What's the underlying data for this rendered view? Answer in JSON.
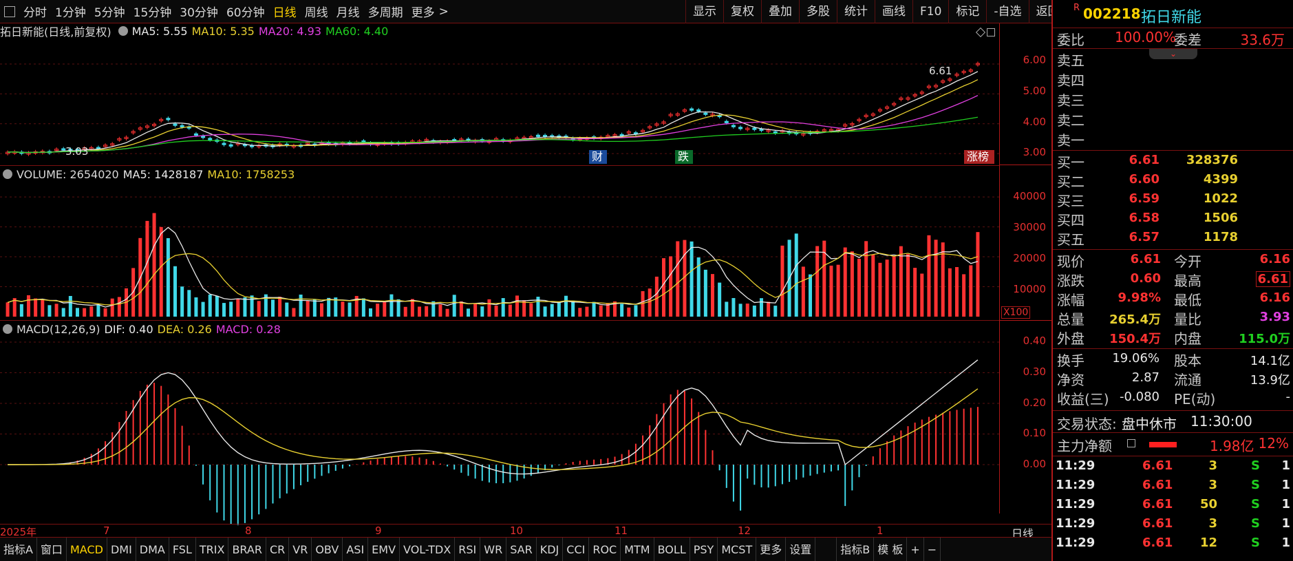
{
  "toolbar": {
    "periods": [
      "分时",
      "1分钟",
      "5分钟",
      "15分钟",
      "30分钟",
      "60分钟",
      "日线",
      "周线",
      "月线",
      "多周期",
      "更多"
    ],
    "active_period": "日线",
    "more_suffix": ">",
    "buttons": [
      "显示",
      "复权",
      "叠加",
      "多股",
      "统计",
      "画线",
      "F10",
      "标记",
      "-自选",
      "返回"
    ]
  },
  "stock": {
    "badge": "R",
    "code": "002218",
    "name": "拓日新能"
  },
  "kline": {
    "title": "拓日新能(日线,前复权)",
    "ma5": "MA5: 5.55",
    "ma10": "MA10: 5.35",
    "ma20": "MA20: 4.93",
    "ma60": "MA60: 4.40",
    "y_ticks": [
      "6.00",
      "5.00",
      "4.00",
      "3.00"
    ],
    "high_label": "6.61",
    "low_label": "3.03",
    "markers": [
      "财",
      "跌",
      "涨榜"
    ]
  },
  "volume": {
    "title": "VOLUME: 2654020",
    "ma5": "MA5: 1428187",
    "ma10": "MA10: 1758253",
    "y_ticks": [
      "40000",
      "30000",
      "20000",
      "10000"
    ],
    "unit": "X100"
  },
  "macd": {
    "title": "MACD(12,26,9)",
    "dif": "DIF: 0.40",
    "dea": "DEA: 0.26",
    "macd": "MACD: 0.28",
    "y_ticks": [
      "0.40",
      "0.30",
      "0.20",
      "0.10",
      "0.00"
    ]
  },
  "x_axis": {
    "labels": [
      "2025年",
      "7",
      "8",
      "9",
      "10",
      "11",
      "12",
      "1"
    ],
    "period_label": "日线"
  },
  "bottom_tabs": [
    "指标A",
    "窗口",
    "MACD",
    "DMI",
    "DMA",
    "FSL",
    "TRIX",
    "BRAR",
    "CR",
    "VR",
    "OBV",
    "ASI",
    "EMV",
    "VOL-TDX",
    "RSI",
    "WR",
    "SAR",
    "KDJ",
    "CCI",
    "ROC",
    "MTM",
    "BOLL",
    "PSY",
    "MCST",
    "更多",
    "设置",
    "指标B",
    "模 板",
    "+",
    "−"
  ],
  "active_tab": "MACD",
  "quote": {
    "weibi_label": "委比",
    "weibi": "100.00%",
    "weicha_label": "委差",
    "weicha": "33.6万",
    "sell": [
      {
        "label": "卖五",
        "price": "",
        "vol": ""
      },
      {
        "label": "卖四",
        "price": "",
        "vol": ""
      },
      {
        "label": "卖三",
        "price": "",
        "vol": ""
      },
      {
        "label": "卖二",
        "price": "",
        "vol": ""
      },
      {
        "label": "卖一",
        "price": "",
        "vol": ""
      }
    ],
    "buy": [
      {
        "label": "买一",
        "price": "6.61",
        "vol": "328376"
      },
      {
        "label": "买二",
        "price": "6.60",
        "vol": "4399"
      },
      {
        "label": "买三",
        "price": "6.59",
        "vol": "1022"
      },
      {
        "label": "买四",
        "price": "6.58",
        "vol": "1506"
      },
      {
        "label": "买五",
        "price": "6.57",
        "vol": "1178"
      }
    ],
    "stats": [
      {
        "k1": "现价",
        "v1": "6.61",
        "c1": "red",
        "k2": "今开",
        "v2": "6.16",
        "c2": "red"
      },
      {
        "k1": "涨跌",
        "v1": "0.60",
        "c1": "red",
        "k2": "最高",
        "v2": "6.61",
        "c2": "red"
      },
      {
        "k1": "涨幅",
        "v1": "9.98%",
        "c1": "red",
        "k2": "最低",
        "v2": "6.16",
        "c2": "red"
      },
      {
        "k1": "总量",
        "v1": "265.4万",
        "c1": "yellow",
        "k2": "量比",
        "v2": "3.93",
        "c2": "magenta"
      },
      {
        "k1": "外盘",
        "v1": "150.4万",
        "c1": "red",
        "k2": "内盘",
        "v2": "115.0万",
        "c2": "green"
      }
    ],
    "fund": [
      {
        "k1": "换手",
        "v1": "19.06%",
        "k2": "股本",
        "v2": "14.1亿"
      },
      {
        "k1": "净资",
        "v1": "2.87",
        "k2": "流通",
        "v2": "13.9亿"
      },
      {
        "k1": "收益(三)",
        "v1": "-0.080",
        "k2": "PE(动)",
        "v2": "-"
      }
    ],
    "status_label": "交易状态:",
    "status": "盘中休市",
    "status_time": "11:30:00",
    "mainforce_label": "主力净额",
    "mainforce": "1.98亿",
    "mainforce_pct": "12%",
    "ticks": [
      {
        "time": "11:29",
        "price": "6.61",
        "vol": "3",
        "bs": "S",
        "n": "1"
      },
      {
        "time": "11:29",
        "price": "6.61",
        "vol": "3",
        "bs": "S",
        "n": "1"
      },
      {
        "time": "11:29",
        "price": "6.61",
        "vol": "50",
        "bs": "S",
        "n": "1"
      },
      {
        "time": "11:29",
        "price": "6.61",
        "vol": "3",
        "bs": "S",
        "n": "1"
      },
      {
        "time": "11:29",
        "price": "6.61",
        "vol": "12",
        "bs": "S",
        "n": "1"
      }
    ]
  },
  "colors": {
    "up": "#ff3232",
    "down": "#40d8e8",
    "ma5": "#e8e8e8",
    "ma10": "#e8d030",
    "ma20": "#e040e0",
    "ma60": "#20d020",
    "frame": "#b01818"
  }
}
